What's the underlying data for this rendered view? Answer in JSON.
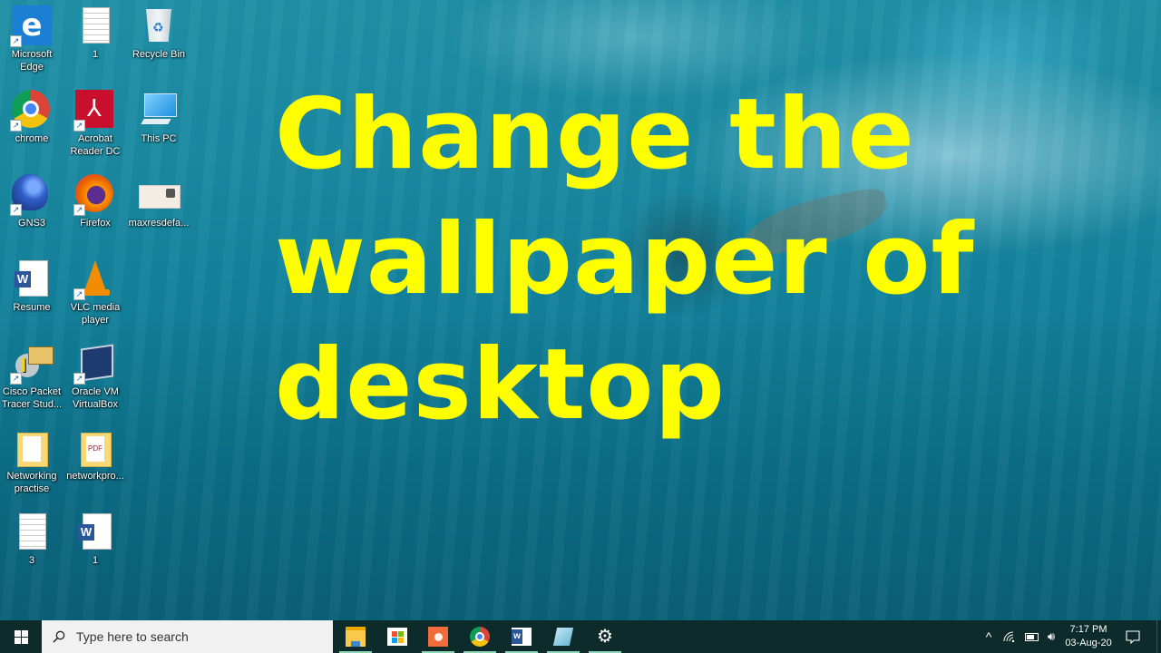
{
  "wallpaper": {
    "headline_lines": [
      "Change the",
      "wallpaper of",
      "desktop"
    ],
    "headline_color": "#ffff00"
  },
  "desktop_icons": [
    {
      "label": "Microsoft Edge",
      "icon": "edge-icon",
      "shortcut": true
    },
    {
      "label": "1",
      "icon": "text-document-icon",
      "shortcut": false
    },
    {
      "label": "Recycle Bin",
      "icon": "recycle-bin-icon",
      "shortcut": false
    },
    {
      "label": "chrome",
      "icon": "chrome-icon",
      "shortcut": true
    },
    {
      "label": "Acrobat Reader DC",
      "icon": "acrobat-icon",
      "shortcut": true
    },
    {
      "label": "This PC",
      "icon": "this-pc-icon",
      "shortcut": false
    },
    {
      "label": "GNS3",
      "icon": "gns3-icon",
      "shortcut": true
    },
    {
      "label": "Firefox",
      "icon": "firefox-icon",
      "shortcut": true
    },
    {
      "label": "maxresdefa...",
      "icon": "image-file-icon",
      "shortcut": false
    },
    {
      "label": "Resume",
      "icon": "word-document-icon",
      "shortcut": false
    },
    {
      "label": "VLC media player",
      "icon": "vlc-icon",
      "shortcut": true
    },
    {
      "label": "Cisco Packet Tracer Stud...",
      "icon": "packet-tracer-icon",
      "shortcut": true
    },
    {
      "label": "Oracle VM VirtualBox",
      "icon": "virtualbox-icon",
      "shortcut": true
    },
    {
      "label": "Networking practise",
      "icon": "folder-icon",
      "shortcut": false
    },
    {
      "label": "networkpro...",
      "icon": "pdf-folder-icon",
      "shortcut": false
    },
    {
      "label": "3",
      "icon": "text-document-icon",
      "shortcut": false
    },
    {
      "label": "1",
      "icon": "word-document-icon",
      "shortcut": false
    }
  ],
  "taskbar": {
    "search_placeholder": "Type here to search",
    "pinned_apps": [
      {
        "name": "File Explorer",
        "icon": "file-explorer-icon"
      },
      {
        "name": "Microsoft Store",
        "icon": "store-icon"
      },
      {
        "name": "Screen recorder",
        "icon": "recorder-icon"
      },
      {
        "name": "Google Chrome",
        "icon": "chrome-icon"
      },
      {
        "name": "Microsoft Word",
        "icon": "word-icon"
      },
      {
        "name": "Notepad",
        "icon": "notepad-icon"
      },
      {
        "name": "Settings",
        "icon": "gear-icon"
      }
    ],
    "tray": {
      "chevron": "^",
      "time": "7:17 PM",
      "date": "03-Aug-20"
    }
  }
}
